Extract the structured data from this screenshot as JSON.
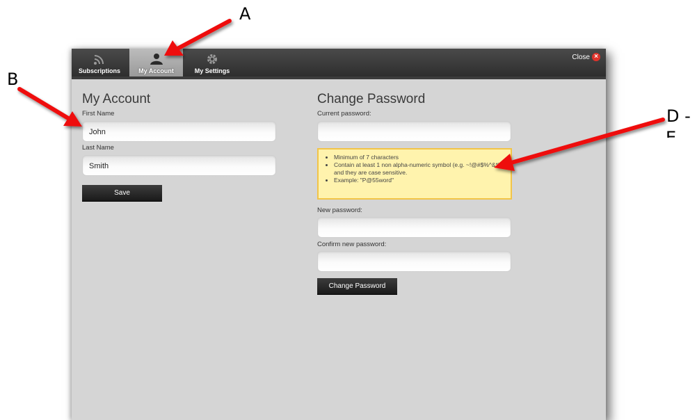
{
  "tabs": [
    {
      "label": "Subscriptions",
      "icon": "rss-icon"
    },
    {
      "label": "My Account",
      "icon": "user-icon"
    },
    {
      "label": "My Settings",
      "icon": "gear-icon"
    }
  ],
  "close_label": "Close",
  "account": {
    "title": "My Account",
    "first_name_label": "First Name",
    "first_name_value": "John",
    "last_name_label": "Last Name",
    "last_name_value": "Smith",
    "save_label": "Save"
  },
  "password": {
    "title": "Change Password",
    "current_label": "Current password:",
    "hints": [
      "Minimum of 7 characters",
      "Contain at least 1 non alpha-numeric symbol (e.g. ~!@#$%^&*) and they are case sensitive.",
      "Example: \"P@55word\""
    ],
    "new_label": "New password:",
    "confirm_label": "Confirm new password:",
    "change_button_label": "Change Password"
  },
  "callouts": {
    "a": "A",
    "b": "B",
    "d": "D -",
    "e": "E"
  },
  "colors": {
    "arrow": "#ee1111",
    "panel": "#d5d5d5",
    "hint_bg": "#fff3ad",
    "hint_border": "#f2c447",
    "close_icon": "#e0332b"
  }
}
